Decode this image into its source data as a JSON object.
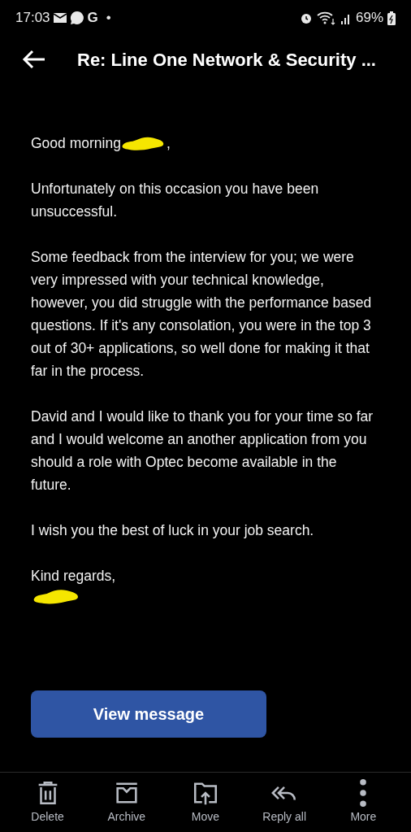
{
  "status_bar": {
    "time": "17:03",
    "notification_g": "G",
    "dot": "•",
    "battery": "69%"
  },
  "header": {
    "title": "Re: Line One Network & Security ..."
  },
  "message": {
    "greeting": "Good morning",
    "greeting_end": ",",
    "paragraphs": [
      "Unfortunately on this occasion you have been unsuccessful.",
      "Some feedback from the interview for you; we were very impressed with your technical knowledge, however, you did struggle with the performance based questions. If it's any consolation, you were in the top 3 out of 30+ applications, so well done for making it that far in the process.",
      "David and I would like to thank you for your time so far and I would welcome an another application from you should a role with Optec become available in the future.",
      "I wish you the best of luck in your job search."
    ],
    "signoff": "Kind regards,"
  },
  "view_button": "View message",
  "toolbar": [
    {
      "kind": "delete",
      "label": "Delete"
    },
    {
      "kind": "archive",
      "label": "Archive"
    },
    {
      "kind": "move",
      "label": "Move"
    },
    {
      "kind": "reply_all",
      "label": "Reply all"
    },
    {
      "kind": "more",
      "label": "More"
    }
  ]
}
